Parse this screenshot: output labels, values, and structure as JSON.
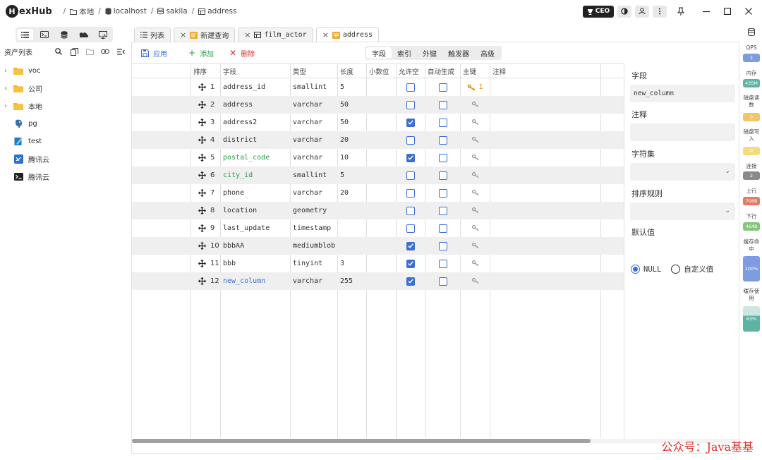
{
  "app": {
    "logo_text": "exHub",
    "logo_letter": "H"
  },
  "breadcrumb": [
    {
      "label": "本地",
      "icon": "folder-icon"
    },
    {
      "label": "localhost",
      "icon": "server-icon"
    },
    {
      "label": "sakila",
      "icon": "database-icon"
    },
    {
      "label": "address",
      "icon": "table-icon"
    }
  ],
  "titlebar": {
    "ceo_label": "CEO"
  },
  "sidebar": {
    "header": "资产列表",
    "tree": [
      {
        "label": "voc",
        "icon": "folder-icon",
        "expandable": true
      },
      {
        "label": "公司",
        "icon": "folder-icon",
        "expandable": true
      },
      {
        "label": "本地",
        "icon": "folder-icon",
        "expandable": true
      },
      {
        "label": "pg",
        "icon": "postgres-icon",
        "expandable": false
      },
      {
        "label": "test",
        "icon": "sqlite-icon",
        "expandable": false
      },
      {
        "label": "腾讯云",
        "icon": "remote-desktop-icon",
        "expandable": false
      },
      {
        "label": "腾讯云",
        "icon": "terminal-icon",
        "expandable": false
      }
    ]
  },
  "tabs": [
    {
      "label": "列表",
      "active": false,
      "closable": false
    },
    {
      "label": "新建查询",
      "active": false,
      "closable": true
    },
    {
      "label": "film_actor",
      "active": false,
      "closable": true
    },
    {
      "label": "address",
      "active": true,
      "closable": true
    }
  ],
  "actions": {
    "apply": "应用",
    "add": "添加",
    "delete": "删除"
  },
  "segments": [
    {
      "label": "字段",
      "active": true
    },
    {
      "label": "索引",
      "active": false
    },
    {
      "label": "外键",
      "active": false
    },
    {
      "label": "触发器",
      "active": false
    },
    {
      "label": "高级",
      "active": false
    }
  ],
  "columns": {
    "order": "排序",
    "field": "字段",
    "type": "类型",
    "length": "长度",
    "decimals": "小数位",
    "nullable": "允许空",
    "auto": "自动生成",
    "pk": "主键",
    "comment": "注释"
  },
  "rows": [
    {
      "order": "1",
      "field": "address_id",
      "type": "smallint",
      "length": "5",
      "decimals": "",
      "nullable": false,
      "auto": false,
      "pk": true,
      "pk_index": "1",
      "color": "default",
      "comment": ""
    },
    {
      "order": "2",
      "field": "address",
      "type": "varchar",
      "length": "50",
      "decimals": "",
      "nullable": false,
      "auto": false,
      "pk": false,
      "pk_index": "",
      "color": "default",
      "comment": ""
    },
    {
      "order": "3",
      "field": "address2",
      "type": "varchar",
      "length": "50",
      "decimals": "",
      "nullable": true,
      "auto": false,
      "pk": false,
      "pk_index": "",
      "color": "default",
      "comment": ""
    },
    {
      "order": "4",
      "field": "district",
      "type": "varchar",
      "length": "20",
      "decimals": "",
      "nullable": false,
      "auto": false,
      "pk": false,
      "pk_index": "",
      "color": "default",
      "comment": ""
    },
    {
      "order": "5",
      "field": "postal_code",
      "type": "varchar",
      "length": "10",
      "decimals": "",
      "nullable": true,
      "auto": false,
      "pk": false,
      "pk_index": "",
      "color": "green",
      "comment": ""
    },
    {
      "order": "6",
      "field": "city_id",
      "type": "smallint",
      "length": "5",
      "decimals": "",
      "nullable": false,
      "auto": false,
      "pk": false,
      "pk_index": "",
      "color": "green",
      "comment": ""
    },
    {
      "order": "7",
      "field": "phone",
      "type": "varchar",
      "length": "20",
      "decimals": "",
      "nullable": false,
      "auto": false,
      "pk": false,
      "pk_index": "",
      "color": "default",
      "comment": ""
    },
    {
      "order": "8",
      "field": "location",
      "type": "geometry",
      "length": "",
      "decimals": "",
      "nullable": false,
      "auto": false,
      "pk": false,
      "pk_index": "",
      "color": "default",
      "comment": ""
    },
    {
      "order": "9",
      "field": "last_update",
      "type": "timestamp",
      "length": "",
      "decimals": "",
      "nullable": false,
      "auto": false,
      "pk": false,
      "pk_index": "",
      "color": "default",
      "comment": ""
    },
    {
      "order": "10",
      "field": "bbbAA",
      "type": "mediumblob",
      "length": "",
      "decimals": "",
      "nullable": true,
      "auto": false,
      "pk": false,
      "pk_index": "",
      "color": "default",
      "comment": ""
    },
    {
      "order": "11",
      "field": "bbb",
      "type": "tinyint",
      "length": "3",
      "decimals": "",
      "nullable": true,
      "auto": false,
      "pk": false,
      "pk_index": "",
      "color": "default",
      "comment": ""
    },
    {
      "order": "12",
      "field": "new_column",
      "type": "varchar",
      "length": "255",
      "decimals": "",
      "nullable": true,
      "auto": false,
      "pk": false,
      "pk_index": "",
      "color": "blue",
      "comment": ""
    }
  ],
  "properties": {
    "field_label": "字段",
    "field_value": "new_column",
    "comment_label": "注释",
    "comment_value": "",
    "charset_label": "字符集",
    "charset_value": "",
    "collation_label": "排序规则",
    "collation_value": "",
    "default_label": "默认值",
    "default_null": "NULL",
    "default_custom": "自定义值",
    "default_selected": "NULL"
  },
  "monitor": [
    {
      "label": "QPS",
      "value": "2",
      "color": "#7f9ce0"
    },
    {
      "label": "内存",
      "value": "435M",
      "color": "#5fb3a3"
    },
    {
      "label": "磁盘读数",
      "value": "0",
      "color": "#f2c46b"
    },
    {
      "label": "磁盘写入",
      "value": "0",
      "color": "#f4dc7a"
    },
    {
      "label": "连接",
      "value": "2",
      "color": "#8a8a8a"
    },
    {
      "label": "上行",
      "value": "708B",
      "color": "#e07b65"
    },
    {
      "label": "下行",
      "value": "464B",
      "color": "#84c77a"
    },
    {
      "label": "缓存命中",
      "value": "100%",
      "color": "#7f9ce0"
    },
    {
      "label": "缓存使用",
      "value": "63%",
      "color": "#5fb3a3",
      "fill": 0.63
    }
  ],
  "watermark": "公众号：Java基基",
  "colors": {
    "accent": "#3b6fd6",
    "green": "#2a9a4a",
    "red": "#d93030",
    "pk": "#e3961a"
  }
}
